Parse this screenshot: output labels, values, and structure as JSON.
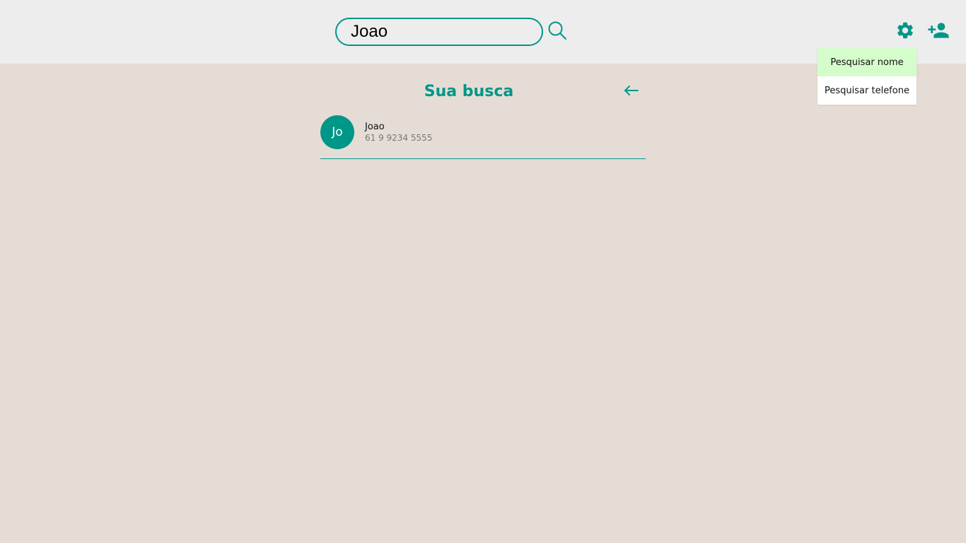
{
  "search": {
    "value": "Joao"
  },
  "icons": {
    "search": "search-icon",
    "settings": "gear-icon",
    "add_contact": "add-user-icon",
    "back": "arrow-left-icon"
  },
  "colors": {
    "accent": "#009688",
    "background": "#e5ddd5",
    "topbar": "#ededed",
    "dropdown_active": "#d5fdcb"
  },
  "dropdown": {
    "items": [
      {
        "label": "Pesquisar nome",
        "active": true
      },
      {
        "label": "Pesquisar telefone",
        "active": false
      }
    ]
  },
  "results": {
    "title": "Sua busca",
    "contacts": [
      {
        "initials": "Jo",
        "name": "Joao",
        "phone": "61 9 9234 5555"
      }
    ]
  }
}
